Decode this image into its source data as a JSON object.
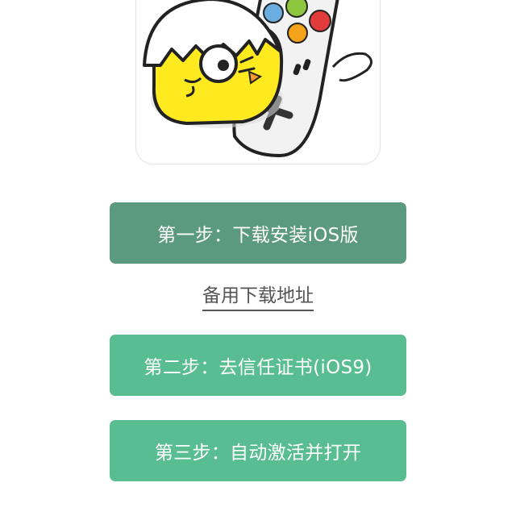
{
  "buttons": {
    "step1": "第一步：下载安装iOS版",
    "step2": "第二步：去信任证书(iOS9)",
    "step3": "第三步：自动激活并打开"
  },
  "links": {
    "backup_download": "备用下载地址"
  },
  "colors": {
    "step1_bg": "#5b9a7e",
    "step_bg": "#58bd90",
    "link_text": "#555555"
  }
}
